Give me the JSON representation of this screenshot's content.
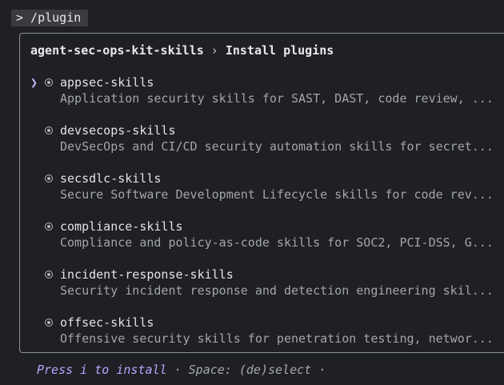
{
  "command": "> /plugin",
  "header": {
    "source": "agent-sec-ops-kit-skills",
    "separator": "›",
    "section": "Install plugins"
  },
  "selected_index": 0,
  "pointer_glyph": "❯",
  "plugins": [
    {
      "name": "appsec-skills",
      "description": "Application security skills for SAST, DAST, code review, ..."
    },
    {
      "name": "devsecops-skills",
      "description": "DevSecOps and CI/CD security automation skills for secret..."
    },
    {
      "name": "secsdlc-skills",
      "description": "Secure Software Development Lifecycle skills for code rev..."
    },
    {
      "name": "compliance-skills",
      "description": "Compliance and policy-as-code skills for SOC2, PCI-DSS, G..."
    },
    {
      "name": "incident-response-skills",
      "description": "Security incident response and detection engineering skil..."
    },
    {
      "name": "offsec-skills",
      "description": "Offensive security skills for penetration testing, networ..."
    }
  ],
  "footer": {
    "primary": "Press i to install",
    "dot": "·",
    "secondary": "Space: (de)select",
    "trailing": "·"
  },
  "colors": {
    "background": "#1f2025",
    "accent": "#b4a8ff",
    "border": "#8d8f97"
  }
}
